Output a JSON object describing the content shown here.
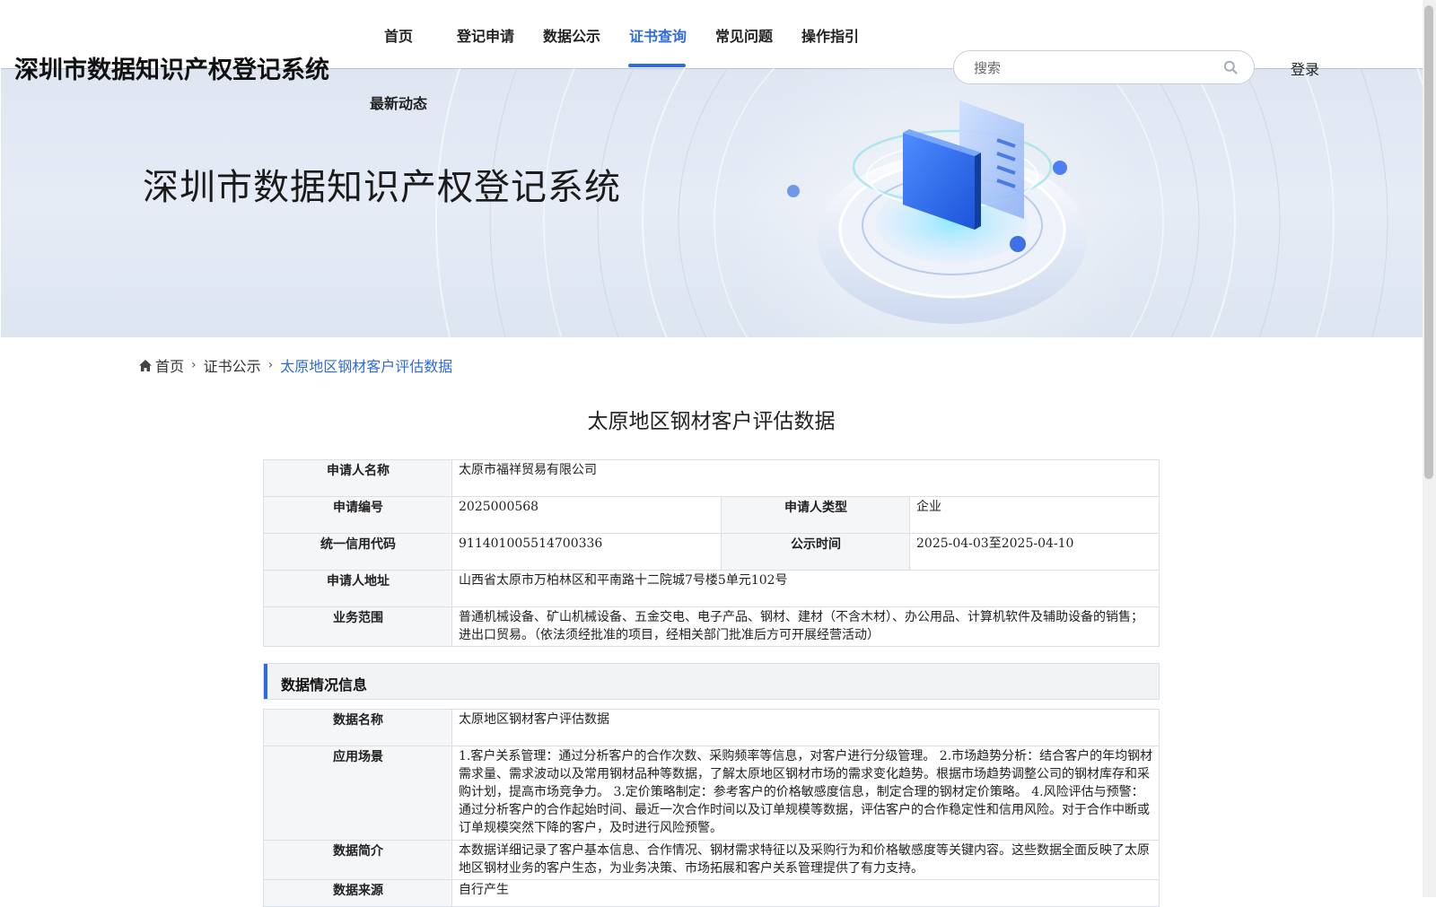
{
  "header": {
    "site_title": "深圳市数据知识产权登记系统",
    "nav": [
      {
        "label": "首页",
        "active": false
      },
      {
        "label": "登记申请",
        "active": false
      },
      {
        "label": "数据公示",
        "active": false
      },
      {
        "label": "证书查询",
        "active": true
      },
      {
        "label": "常见问题",
        "active": false
      },
      {
        "label": "操作指引",
        "active": false
      },
      {
        "label": "最新动态",
        "active": false
      }
    ],
    "search": {
      "placeholder": "搜索",
      "value": ""
    },
    "login_label": "登录"
  },
  "banner": {
    "title": "深圳市数据知识产权登记系统"
  },
  "breadcrumb": [
    {
      "label": "首页"
    },
    {
      "label": "证书公示"
    },
    {
      "label": "太原地区钢材客户评估数据"
    }
  ],
  "page_title": "太原地区钢材客户评估数据",
  "applicant": {
    "name_label": "申请人名称",
    "name": "太原市福祥贸易有限公司",
    "app_no_label": "申请编号",
    "app_no": "2025000568",
    "type_label": "申请人类型",
    "type": "企业",
    "credit_code_label": "统一信用代码",
    "credit_code": "911401005514700336",
    "publicity_label": "公示时间",
    "publicity": "2025-04-03至2025-04-10",
    "address_label": "申请人地址",
    "address": "山西省太原市万柏林区和平南路十二院城7号楼5单元102号",
    "scope_label": "业务范围",
    "scope": "普通机械设备、矿山机械设备、五金交电、电子产品、钢材、建材（不含木材）、办公用品、计算机软件及辅助设备的销售；进出口贸易。（依法须经批准的项目，经相关部门批准后方可开展经营活动）"
  },
  "data_section": {
    "heading": "数据情况信息",
    "name_label": "数据名称",
    "name": "太原地区钢材客户评估数据",
    "scenario_label": "应用场景",
    "scenario": "1.客户关系管理：通过分析客户的合作次数、采购频率等信息，对客户进行分级管理。 2.市场趋势分析：结合客户的年均钢材需求量、需求波动以及常用钢材品种等数据，了解太原地区钢材市场的需求变化趋势。根据市场趋势调整公司的钢材库存和采购计划，提高市场竞争力。 3.定价策略制定：参考客户的价格敏感度信息，制定合理的钢材定价策略。 4.风险评估与预警：通过分析客户的合作起始时间、最近一次合作时间以及订单规模等数据，评估客户的合作稳定性和信用风险。对于合作中断或订单规模突然下降的客户，及时进行风险预警。",
    "intro_label": "数据简介",
    "intro": "本数据详细记录了客户基本信息、合作情况、钢材需求特征以及采购行为和价格敏感度等关键内容。这些数据全面反映了太原地区钢材业务的客户生态，为业务决策、市场拓展和客户关系管理提供了有力支持。",
    "source_label": "数据来源",
    "source": "自行产生"
  },
  "colors": {
    "accent": "#2f6be0",
    "label_bg": "#f5f6f8",
    "border": "#dcdfe5"
  }
}
